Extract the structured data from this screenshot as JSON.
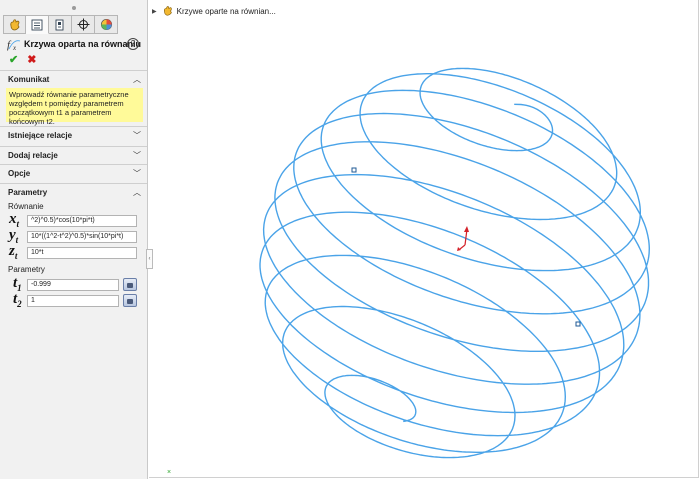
{
  "property_manager": {
    "title": "Krzywa oparta na równaniu",
    "help_symbol": "?",
    "ok_symbol": "✔",
    "cancel_symbol": "✖",
    "tabs": [
      {
        "name": "featuremanager-icon",
        "glyph": "✋"
      },
      {
        "name": "propertymanager-icon",
        "glyph": "▤"
      },
      {
        "name": "configurationmanager-icon",
        "glyph": "◫"
      },
      {
        "name": "dimxpert-icon",
        "glyph": "⌖"
      },
      {
        "name": "display-manager-icon",
        "glyph": "◕"
      }
    ],
    "message_group": {
      "title": "Komunikat",
      "text": "Wprowadź równanie parametryczne względem t pomiędzy parametrem początkowym t1 a parametrem końcowym t2."
    },
    "existing_relations": "Istniejące relacje",
    "add_relations": "Dodaj relacje",
    "options": "Opcje",
    "parameters_group": {
      "title": "Parametry",
      "equations_label": "Równanie",
      "x_label": "x",
      "y_label": "y",
      "z_label": "z",
      "t_sub": "t",
      "x_value": "^2)^0.5)*cos(10*pi*t)",
      "y_value": "10*((1^2-t^2)^0.5)*sin(10*pi*t)",
      "z_value": "10*t",
      "params_label": "Parametry",
      "t1_label": "t",
      "t1_sub": "1",
      "t1_value": "-0.999",
      "t2_label": "t",
      "t2_sub": "2",
      "t2_value": "1"
    }
  },
  "tree": {
    "item": "Krzywe oparte na równian..."
  },
  "colors": {
    "curve": "#4aa3e8",
    "triad_red": "#d4222a",
    "yellow_message": "#fffa99"
  }
}
